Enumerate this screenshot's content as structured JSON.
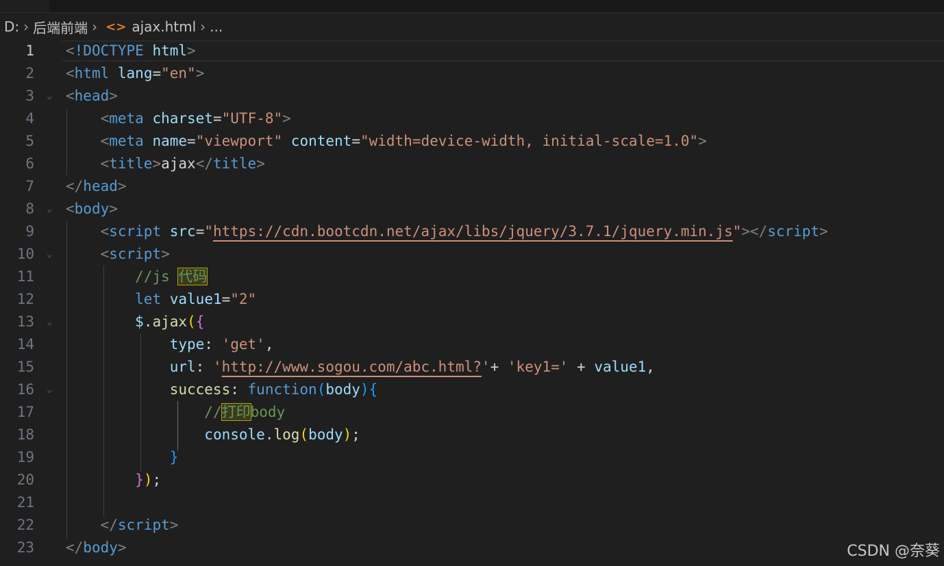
{
  "breadcrumb": {
    "drive": "D:",
    "folder": "后端前端",
    "file": "ajax.html",
    "more": "..."
  },
  "editor": {
    "active_line": 1,
    "lines": [
      {
        "n": "1"
      },
      {
        "n": "2"
      },
      {
        "n": "3"
      },
      {
        "n": "4"
      },
      {
        "n": "5"
      },
      {
        "n": "6"
      },
      {
        "n": "7"
      },
      {
        "n": "8"
      },
      {
        "n": "9"
      },
      {
        "n": "10"
      },
      {
        "n": "11"
      },
      {
        "n": "12"
      },
      {
        "n": "13"
      },
      {
        "n": "14"
      },
      {
        "n": "15"
      },
      {
        "n": "16"
      },
      {
        "n": "17"
      },
      {
        "n": "18"
      },
      {
        "n": "19"
      },
      {
        "n": "20"
      },
      {
        "n": "21"
      },
      {
        "n": "22"
      },
      {
        "n": "23"
      }
    ],
    "tokens": {
      "doctype": "!DOCTYPE",
      "doctype_html": "html",
      "html_tag": "html",
      "lang_attr": "lang",
      "lang_val": "\"en\"",
      "head_tag": "head",
      "meta_tag": "meta",
      "charset_attr": "charset",
      "charset_val": "\"UTF-8\"",
      "name_attr": "name",
      "name_val": "\"viewport\"",
      "content_attr": "content",
      "content_val": "\"width=device-width, initial-scale=1.0\"",
      "title_tag": "title",
      "title_text": "ajax",
      "body_tag": "body",
      "script_tag": "script",
      "src_attr": "src",
      "src_val_q": "\"",
      "src_url": "https://cdn.bootcdn.net/ajax/libs/jquery/3.7.1/jquery.min.js",
      "comment1_prefix": "//js ",
      "comment1_cn": "代码",
      "let_kw": "let",
      "value1_var": "value1",
      "value1_val": "\"2\"",
      "jq": "$",
      "ajax_fn": "ajax",
      "type_key": "type",
      "type_val": "'get'",
      "url_key": "url",
      "url_q": "'",
      "url_link": "http://www.sogou.com/abc.html?",
      "key1_str": "'key1='",
      "success_key": "success",
      "function_kw": "function",
      "body_param": "body",
      "comment2_prefix": "//",
      "comment2_cn": "打印",
      "comment2_suffix": "body",
      "console_obj": "console",
      "log_fn": "log"
    }
  },
  "watermark": "CSDN @奈葵"
}
